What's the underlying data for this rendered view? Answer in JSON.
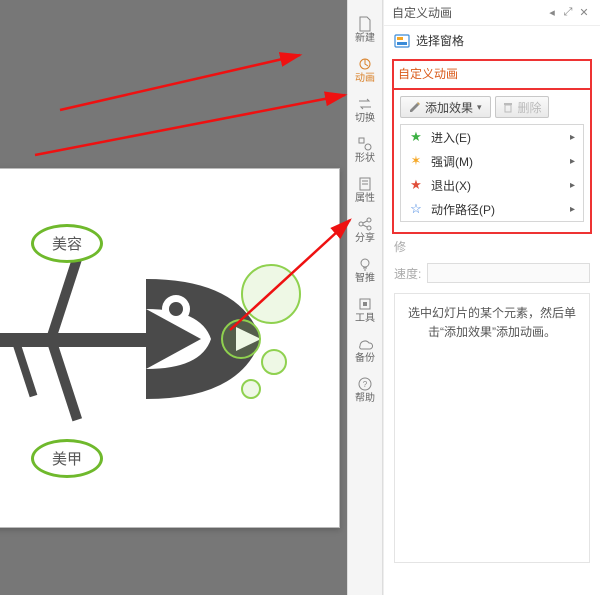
{
  "panel": {
    "title": "自定义动画",
    "select_pane": "选择窗格",
    "section_title": "自定义动画",
    "add_effect": "添加效果",
    "delete": "删除",
    "menu": {
      "enter": {
        "label": "进入(E)",
        "star_color": "#3cb043"
      },
      "emph": {
        "label": "强调(M)",
        "star_color": "#f5a623"
      },
      "exit": {
        "label": "退出(X)",
        "star_color": "#e04f3a"
      },
      "motion": {
        "label": "动作路径(P)",
        "star_color": "#3a7fe0"
      }
    },
    "prop_modify": "修",
    "prop_speed": "速度:",
    "hint": "选中幻灯片的某个元素，然后单击“添加效果”添加动画。"
  },
  "sidebar": {
    "items": [
      {
        "label": "新建",
        "icon": "file"
      },
      {
        "label": "动画",
        "icon": "anim",
        "active": true
      },
      {
        "label": "切换",
        "icon": "swap"
      },
      {
        "label": "形状",
        "icon": "shape"
      },
      {
        "label": "属性",
        "icon": "prop"
      },
      {
        "label": "分享",
        "icon": "share"
      },
      {
        "label": "智推",
        "icon": "bulb"
      },
      {
        "label": "工具",
        "icon": "tool"
      },
      {
        "label": "备份",
        "icon": "backup"
      },
      {
        "label": "帮助",
        "icon": "help"
      }
    ]
  },
  "slide": {
    "label_a": "美容",
    "label_b": "美甲"
  }
}
